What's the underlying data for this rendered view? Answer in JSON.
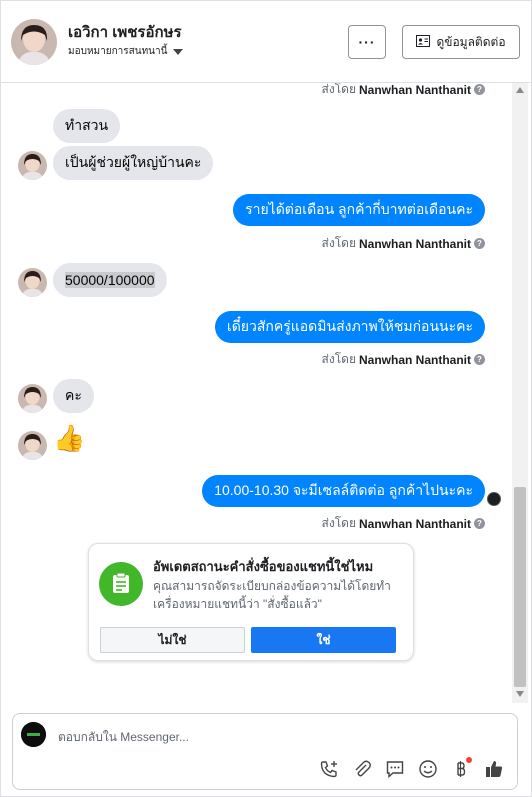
{
  "header": {
    "name": "เอวิกา เพชรอักษร",
    "assign_label": "มอบหมายการสนทนานี้",
    "more_label": "···",
    "contact_label": "ดูข้อมูลติดต่อ"
  },
  "chat": {
    "sent_by_prefix": "ส่งโดย",
    "sender_name": "Nanwhan Nanthanit",
    "help_glyph": "?",
    "incoming": [
      {
        "text": "ทำสวน"
      },
      {
        "text": "เป็นผู้ช่วยผู้ใหญ่บ้านคะ"
      },
      {
        "text": "50000/100000"
      },
      {
        "text": "คะ"
      }
    ],
    "thumbs_up": "👍",
    "outgoing": [
      {
        "text": "รายได้ต่อเดือน ลูกค้ากี่บาทต่อเดือนคะ"
      },
      {
        "text": "เดี๋ยวสักครู่แอดมินส่งภาพให้ชมก่อนนะคะ"
      },
      {
        "text": "10.00-10.30 จะมีเซลล์ติดต่อ ลูกค้าไปนะคะ"
      }
    ]
  },
  "card": {
    "title": "อัพเดตสถานะคำสั่งซื้อของแชทนี้ใช่ไหม",
    "body": "คุณสามารถจัดระเบียบกล่องข้อความได้โดยทำเครื่องหมายแชทนี้ว่า \"สั่งซื้อแล้ว\"",
    "no_label": "ไม่ใช่",
    "yes_label": "ใช่",
    "icon": "order-icon"
  },
  "composer": {
    "placeholder": "ตอบกลับใน Messenger..."
  },
  "colors": {
    "outgoing_bubble": "#0084ff",
    "incoming_bubble": "#e4e6eb",
    "primary_button": "#1877f2",
    "card_icon_bg": "#42b72a"
  }
}
